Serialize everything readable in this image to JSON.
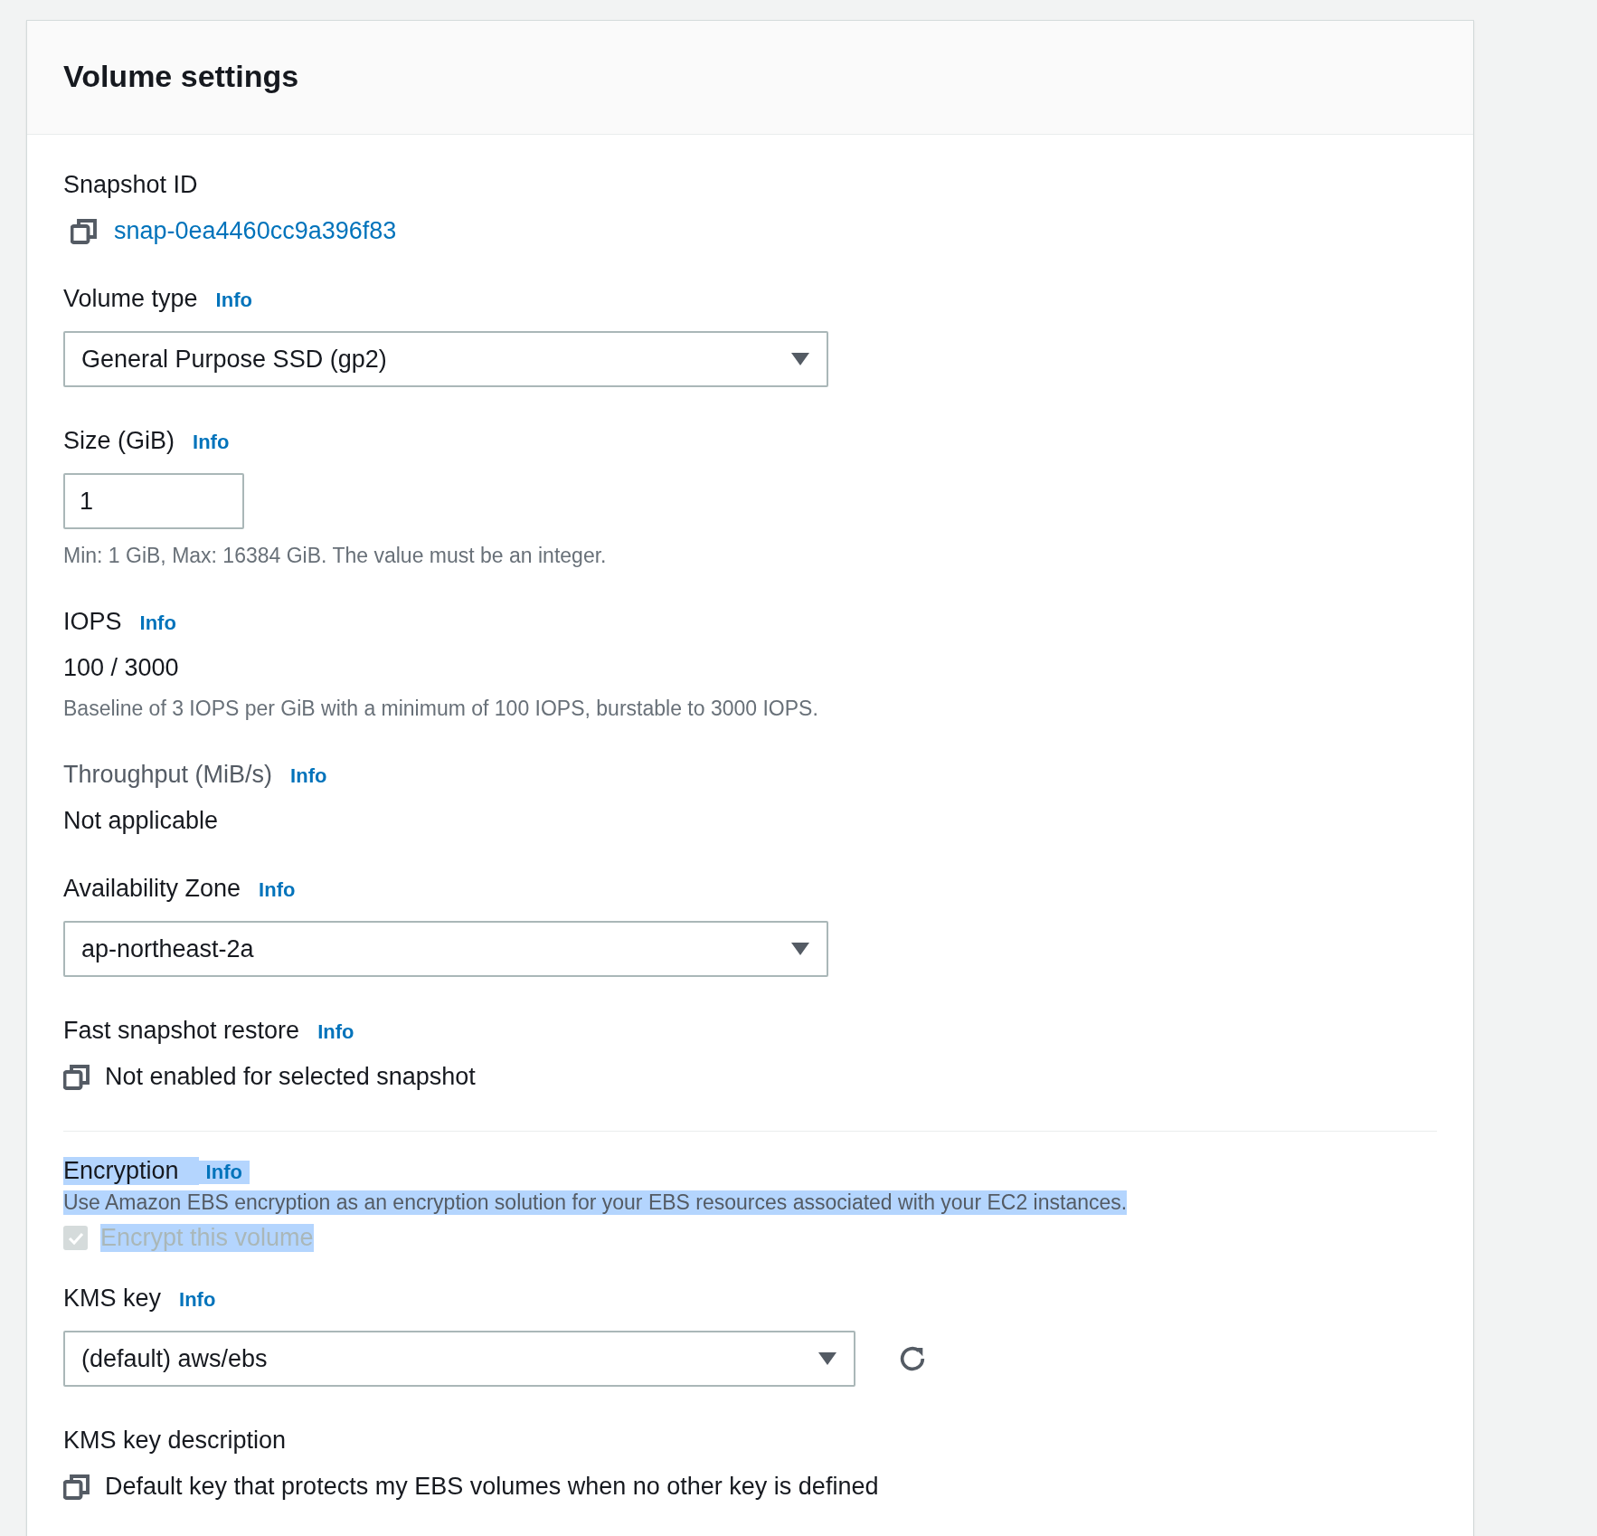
{
  "panel": {
    "title": "Volume settings"
  },
  "fields": [
    {
      "kind": "link",
      "label": "Snapshot ID",
      "value": "snap-0ea4460cc9a396f83"
    },
    {
      "kind": "select",
      "label": "Volume type",
      "info": "Info",
      "value": "General Purpose SSD (gp2)"
    },
    {
      "kind": "input",
      "label": "Size (GiB)",
      "info": "Info",
      "value": "1",
      "hint": "Min: 1 GiB, Max: 16384 GiB. The value must be an integer."
    },
    {
      "kind": "value",
      "label": "IOPS",
      "info": "Info",
      "value": "100 / 3000",
      "hint": "Baseline of 3 IOPS per GiB with a minimum of 100 IOPS, burstable to 3000 IOPS."
    },
    {
      "kind": "value",
      "label": "Throughput (MiB/s)",
      "info": "Info",
      "disabled": true,
      "value": "Not applicable"
    },
    {
      "kind": "select",
      "label": "Availability Zone",
      "info": "Info",
      "value": "ap-northeast-2a"
    },
    {
      "kind": "copy",
      "label": "Fast snapshot restore",
      "info": "Info",
      "value": "Not enabled for selected snapshot"
    }
  ],
  "encryption": {
    "label": "Encryption",
    "info": "Info",
    "highlighted": true,
    "description": "Use Amazon EBS encryption as an encryption solution for your EBS resources associated with your EC2 instances.",
    "checkbox": {
      "label": "Encrypt this volume",
      "checked": true,
      "disabled": true
    }
  },
  "kms": [
    {
      "kind": "select-refresh",
      "label": "KMS key",
      "info": "Info",
      "value": "(default) aws/ebs"
    },
    {
      "kind": "copy",
      "label": "KMS key description",
      "value": "Default key that protects my EBS volumes when no other key is defined"
    }
  ]
}
